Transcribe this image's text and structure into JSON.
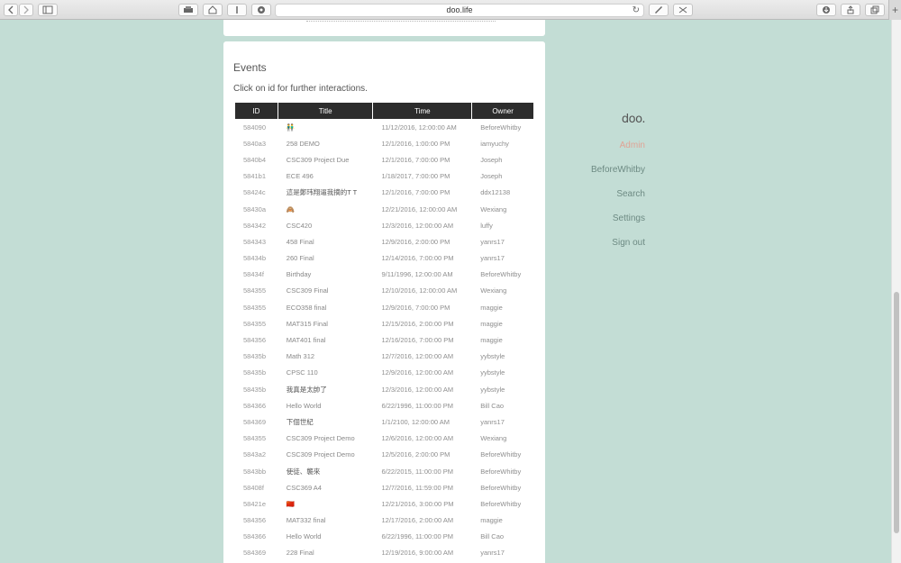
{
  "browser": {
    "url": "doo.life"
  },
  "events": {
    "title": "Events",
    "subtitle": "Click on id for further interactions.",
    "columns": [
      "ID",
      "Title",
      "Time",
      "Owner"
    ],
    "rows": [
      [
        "584090",
        "👬",
        "11/12/2016, 12:00:00 AM",
        "BeforeWhitby"
      ],
      [
        "5840a3",
        "258 DEMO",
        "12/1/2016, 1:00:00 PM",
        "iamyuchy"
      ],
      [
        "5840b4",
        "CSC309 Project Due",
        "12/1/2016, 7:00:00 PM",
        "Joseph"
      ],
      [
        "5841b1",
        "ECE 496",
        "1/18/2017, 7:00:00 PM",
        "Joseph"
      ],
      [
        "58424c",
        "這是鄭玮翔逼我摘的T T",
        "12/1/2016, 7:00:00 PM",
        "ddx12138"
      ],
      [
        "58430a",
        "🙈",
        "12/21/2016, 12:00:00 AM",
        "Wexiang"
      ],
      [
        "584342",
        "CSC420",
        "12/3/2016, 12:00:00 AM",
        "luffy"
      ],
      [
        "584343",
        "458 Final",
        "12/9/2016, 2:00:00 PM",
        "yanrs17"
      ],
      [
        "58434b",
        "260 Final",
        "12/14/2016, 7:00:00 PM",
        "yanrs17"
      ],
      [
        "58434f",
        "Birthday",
        "9/11/1996, 12:00:00 AM",
        "BeforeWhitby"
      ],
      [
        "584355",
        "CSC309 Final",
        "12/10/2016, 12:00:00 AM",
        "Wexiang"
      ],
      [
        "584355",
        "ECO358 final",
        "12/9/2016, 7:00:00 PM",
        "maggie"
      ],
      [
        "584355",
        "MAT315 Final",
        "12/15/2016, 2:00:00 PM",
        "maggie"
      ],
      [
        "584356",
        "MAT401 final",
        "12/16/2016, 7:00:00 PM",
        "maggie"
      ],
      [
        "58435b",
        "Math 312",
        "12/7/2016, 12:00:00 AM",
        "yybstyle"
      ],
      [
        "58435b",
        "CPSC 110",
        "12/9/2016, 12:00:00 AM",
        "yybstyle"
      ],
      [
        "58435b",
        "我真是太帥了",
        "12/3/2016, 12:00:00 AM",
        "yybstyle"
      ],
      [
        "584366",
        "Hello World",
        "6/22/1996, 11:00:00 PM",
        "Bill Cao"
      ],
      [
        "584369",
        "下個世紀",
        "1/1/2100, 12:00:00 AM",
        "yanrs17"
      ],
      [
        "584355",
        "CSC309 Project Demo",
        "12/6/2016, 12:00:00 AM",
        "Wexiang"
      ],
      [
        "5843a2",
        "CSC309 Project Demo",
        "12/5/2016, 2:00:00 PM",
        "BeforeWhitby"
      ],
      [
        "5843bb",
        "使徒、襲來",
        "6/22/2015, 11:00:00 PM",
        "BeforeWhitby"
      ],
      [
        "58408f",
        "CSC369 A4",
        "12/7/2016, 11:59:00 PM",
        "BeforeWhitby"
      ],
      [
        "58421e",
        "🇨🇳",
        "12/21/2016, 3:00:00 PM",
        "BeforeWhitby"
      ],
      [
        "584356",
        "MAT332 final",
        "12/17/2016, 2:00:00 AM",
        "maggie"
      ],
      [
        "584366",
        "Hello World",
        "6/22/1996, 11:00:00 PM",
        "Bill Cao"
      ],
      [
        "584369",
        "228 Final",
        "12/19/2016, 9:00:00 AM",
        "yanrs17"
      ]
    ]
  },
  "nav": {
    "logo": "doo.",
    "items": [
      "Admin",
      "BeforeWhitby",
      "Search",
      "Settings",
      "Sign out"
    ],
    "active_index": 0,
    "active_color": "#e0a496"
  },
  "theme": {
    "background": "#c3ddd5",
    "header_bg": "#2c2c2c"
  }
}
